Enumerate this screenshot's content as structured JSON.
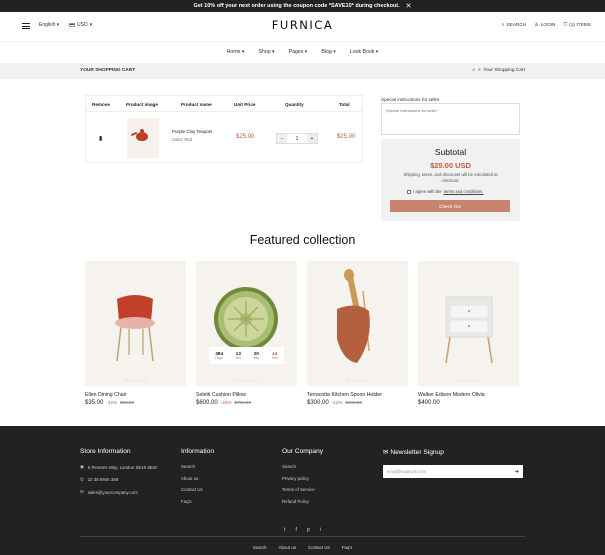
{
  "announcement": {
    "text": "Get 10% off your next order using the coupon code *SAVE10* during checkout.",
    "close": "✕"
  },
  "header": {
    "language": "English",
    "currency": "USD",
    "logo": "FURNICA",
    "search_label": "SEARCH",
    "login_label": "LOGIN",
    "cart_count": "(1)",
    "items_label": "ITEMS"
  },
  "nav": [
    "Home",
    "Shop",
    "Pages",
    "Blog",
    "Look Book"
  ],
  "breadcrumb": {
    "title": "YOUR SHOPPING CART",
    "sep": ">",
    "current": "Your Shopping Cart"
  },
  "cart": {
    "headers": {
      "remove": "Remove",
      "image": "Product image",
      "name": "Product name",
      "unit": "Unit Price",
      "quantity": "Quantity",
      "total": "Total"
    },
    "item": {
      "name": "Purple Clay Teapots",
      "variant": "Color: Red",
      "unit_price": "$25.00",
      "quantity": "1",
      "minus": "−",
      "plus": "+",
      "total": "$25.00"
    }
  },
  "instructions": {
    "label": "Special instructions for seller",
    "placeholder": "Special instructions for seller"
  },
  "subtotal": {
    "title": "Subtotal",
    "amount": "$25.00 USD",
    "note": "Shipping, taxes, and discounts will be calculated at checkout.",
    "agree_prefix": "I agree with the",
    "agree_link": "terms and conditions.",
    "checkout_label": "Check Out"
  },
  "featured": {
    "title": "Featured collection",
    "stars": "☆☆☆☆☆",
    "products": [
      {
        "name": "Ellen Dining Chair",
        "price": "$35.00",
        "off": "-42%",
        "old": "$60.00"
      },
      {
        "name": "Seletti Cushion Pillow",
        "price": "$600.00",
        "off": "-20%",
        "old": "$750.00",
        "countdown": [
          {
            "value": "384",
            "unit": "Days"
          },
          {
            "value": "13",
            "unit": "Hrs"
          },
          {
            "value": "20",
            "unit": "Min"
          },
          {
            "value": "44",
            "unit": "Sec"
          }
        ]
      },
      {
        "name": "Terracotta Kitchen Spoon Holder",
        "price": "$300.00",
        "off": "-12%",
        "old": "$340.00"
      },
      {
        "name": "Walker Edison Modern Olivia",
        "price": "$400.00",
        "off": "",
        "old": ""
      }
    ]
  },
  "footer": {
    "store": {
      "title": "Store Information",
      "address": "6 Pentnes Way, London SE10 8EW",
      "phone": "22 38 8946 358",
      "email": "sales@yourcompany.com"
    },
    "information": {
      "title": "Information",
      "links": [
        "Search",
        "About us",
        "Contact Us",
        "Faq's"
      ]
    },
    "company": {
      "title": "Our Company",
      "links": [
        "Search",
        "Privacy policy",
        "Terms of Service",
        "Refund Policy"
      ]
    },
    "newsletter": {
      "title": "Newsletter Signup",
      "placeholder": "email@example.com",
      "submit": "➔"
    },
    "social": [
      "t",
      "f",
      "p",
      "i"
    ],
    "bottom_links": [
      "Search",
      "About us",
      "Contact Us",
      "Faq's"
    ]
  },
  "colors": {
    "accent": "#c25b45",
    "button": "#c98470",
    "footer_bg": "#222222"
  }
}
